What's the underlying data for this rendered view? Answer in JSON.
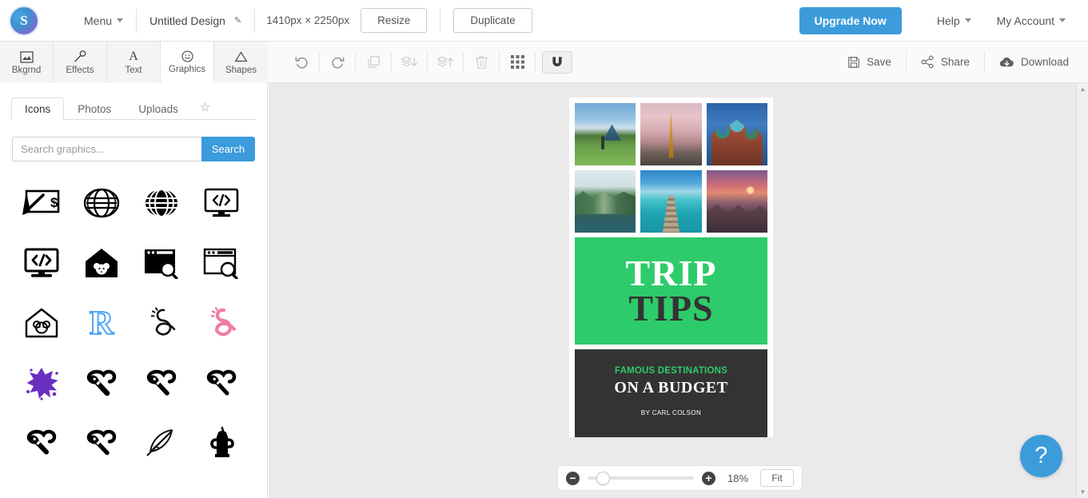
{
  "topbar": {
    "logo_letter": "S",
    "menu_label": "Menu",
    "doc_title": "Untitled Design",
    "edit_icon": "pencil-icon",
    "dimensions": "1410px × 2250px",
    "resize_label": "Resize",
    "duplicate_label": "Duplicate",
    "upgrade_label": "Upgrade Now",
    "help_label": "Help",
    "account_label": "My Account",
    "upgrade_color": "#3c9cdb"
  },
  "tool_tabs": [
    {
      "label": "Bkgrnd",
      "icon": "image-icon",
      "active": false
    },
    {
      "label": "Effects",
      "icon": "wand-icon",
      "active": false
    },
    {
      "label": "Text",
      "icon": "text-a-icon",
      "active": false
    },
    {
      "label": "Graphics",
      "icon": "smiley-icon",
      "active": true
    },
    {
      "label": "Shapes",
      "icon": "triangle-icon",
      "active": false
    }
  ],
  "toolbar": {
    "buttons": [
      {
        "name": "undo-button",
        "icon": "undo-icon",
        "enabled": true
      },
      {
        "name": "redo-button",
        "icon": "redo-icon",
        "enabled": true
      },
      {
        "name": "duplicate-button",
        "icon": "copy-icon",
        "enabled": false
      },
      {
        "name": "send-backward-button",
        "icon": "layers-down-icon",
        "enabled": false
      },
      {
        "name": "bring-forward-button",
        "icon": "layers-up-icon",
        "enabled": false
      },
      {
        "name": "delete-button",
        "icon": "trash-icon",
        "enabled": false
      },
      {
        "name": "grid-button",
        "icon": "grid-icon",
        "enabled": true
      },
      {
        "name": "snap-button",
        "icon": "magnet-icon",
        "enabled": true
      }
    ],
    "save_label": "Save",
    "share_label": "Share",
    "download_label": "Download"
  },
  "panel": {
    "tabs": [
      {
        "label": "Icons",
        "active": true
      },
      {
        "label": "Photos",
        "active": false
      },
      {
        "label": "Uploads",
        "active": false
      }
    ],
    "favorites_icon": "star-icon",
    "search": {
      "value": "",
      "placeholder": "Search graphics...",
      "button_label": "Search"
    },
    "icons": [
      {
        "name": "cheque-pen-dollar-icon"
      },
      {
        "name": "globe-outline-icon"
      },
      {
        "name": "globe-filled-icon"
      },
      {
        "name": "monitor-code-outline-icon"
      },
      {
        "name": "monitor-code-filled-icon"
      },
      {
        "name": "house-mouse-filled-icon"
      },
      {
        "name": "browser-search-filled-icon"
      },
      {
        "name": "browser-search-outline-icon"
      },
      {
        "name": "house-mouse-outline-icon"
      },
      {
        "name": "letter-r-blue-icon"
      },
      {
        "name": "ampersand-outline-icon"
      },
      {
        "name": "ampersand-pink-icon"
      },
      {
        "name": "splat-purple-icon"
      },
      {
        "name": "microphone-black-icon-1"
      },
      {
        "name": "microphone-black-icon-2"
      },
      {
        "name": "microphone-black-icon-3"
      },
      {
        "name": "microphone-black-icon-4"
      },
      {
        "name": "microphone-black-icon-5"
      },
      {
        "name": "bow-arrow-outline-icon"
      },
      {
        "name": "teapot-filled-icon"
      }
    ]
  },
  "design": {
    "photos": [
      {
        "alt": "hiker-on-green-mountain"
      },
      {
        "alt": "eiffel-tower-at-dusk"
      },
      {
        "alt": "saint-basils-cathedral"
      },
      {
        "alt": "woman-on-boat-in-lagoon"
      },
      {
        "alt": "wooden-pier-turquoise-sea"
      },
      {
        "alt": "coastal-cliffs-at-sunset"
      }
    ],
    "title_line1": "TRIP",
    "title_line2": "TIPS",
    "green_color": "#2ecb6a",
    "dark_color": "#333333",
    "subtitle": "FAMOUS DESTINATIONS",
    "headline": "ON A BUDGET",
    "byline": "BY CARL COLSON"
  },
  "zoom_bar": {
    "zoom_out_icon": "minus-circle-icon",
    "zoom_in_icon": "plus-circle-icon",
    "value": "18%",
    "fit_label": "Fit",
    "slider_position_pct": 8
  },
  "help_fab": {
    "icon": "question-mark-icon",
    "color": "#3c9cdb"
  }
}
